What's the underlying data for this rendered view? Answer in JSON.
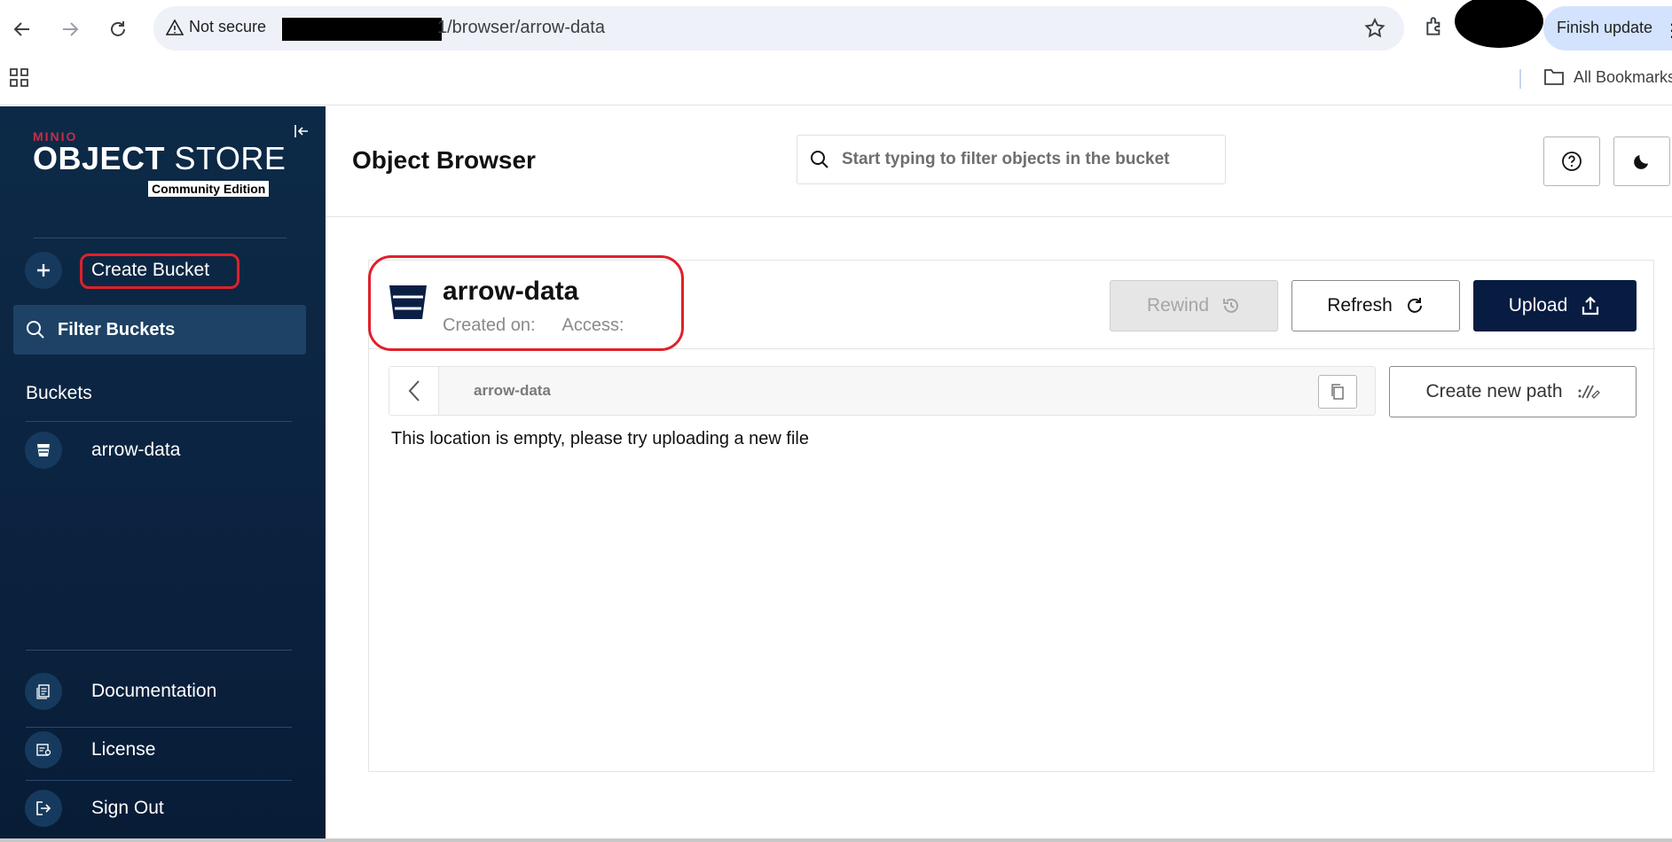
{
  "browser": {
    "security_label": "Not secure",
    "url_path": "1/browser/arrow-data",
    "finish_update_label": "Finish update",
    "all_bookmarks_label": "All Bookmarks"
  },
  "sidebar": {
    "brand": "MINIO",
    "product_bold": "OBJECT",
    "product_light": "STORE",
    "edition": "Community Edition",
    "create_bucket_label": "Create Bucket",
    "filter_buckets_label": "Filter Buckets",
    "buckets_title": "Buckets",
    "buckets": [
      {
        "label": "arrow-data"
      }
    ],
    "footer_items": [
      {
        "label": "Documentation",
        "icon": "documentation-icon"
      },
      {
        "label": "License",
        "icon": "license-icon"
      },
      {
        "label": "Sign Out",
        "icon": "sign-out-icon"
      }
    ]
  },
  "header": {
    "title": "Object Browser",
    "search_placeholder": "Start typing to filter objects in the bucket"
  },
  "bucket": {
    "name": "arrow-data",
    "created_label": "Created on:",
    "access_label": "Access:",
    "rewind_label": "Rewind",
    "refresh_label": "Refresh",
    "upload_label": "Upload",
    "path": "arrow-data",
    "create_path_label": "Create new path",
    "empty_message": "This location is empty, please try uploading a new file"
  },
  "colors": {
    "sidebar_bg": "#0c2a47",
    "primary_button": "#081c42",
    "annotation_red": "#e0202b",
    "brand_red": "#c72c48"
  }
}
